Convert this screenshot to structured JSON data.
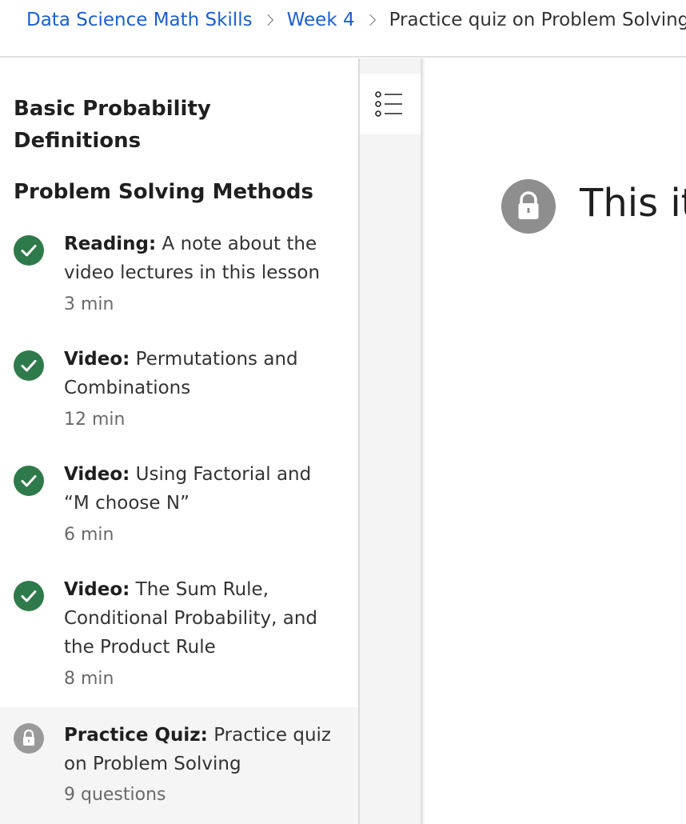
{
  "breadcrumb": {
    "course": "Data Science Math Skills",
    "week": "Week 4",
    "current": "Practice quiz on Problem Solving"
  },
  "sidebar": {
    "sections": [
      {
        "title": "Basic Probability Definitions"
      },
      {
        "title": "Problem Solving Methods"
      }
    ],
    "items": [
      {
        "type": "Reading:",
        "title": "A note about the video lectures in this lesson",
        "meta": "3 min",
        "status": "completed"
      },
      {
        "type": "Video:",
        "title": "Permutations and Combinations",
        "meta": "12 min",
        "status": "completed"
      },
      {
        "type": "Video:",
        "title": "Using Factorial and “M choose N”",
        "meta": "6 min",
        "status": "completed"
      },
      {
        "type": "Video:",
        "title": "The Sum Rule, Conditional Probability, and the Product Rule",
        "meta": "8 min",
        "status": "completed"
      },
      {
        "type": "Practice Quiz:",
        "title": "Practice quiz on Problem Solving",
        "meta": "9 questions",
        "status": "locked"
      }
    ]
  },
  "rail": {
    "icon": "list-icon"
  },
  "main": {
    "heading": "This it",
    "icon": "lock-icon"
  },
  "colors": {
    "link": "#1b5fd1",
    "completed": "#2f7a4a",
    "locked": "#9a9a9a"
  }
}
